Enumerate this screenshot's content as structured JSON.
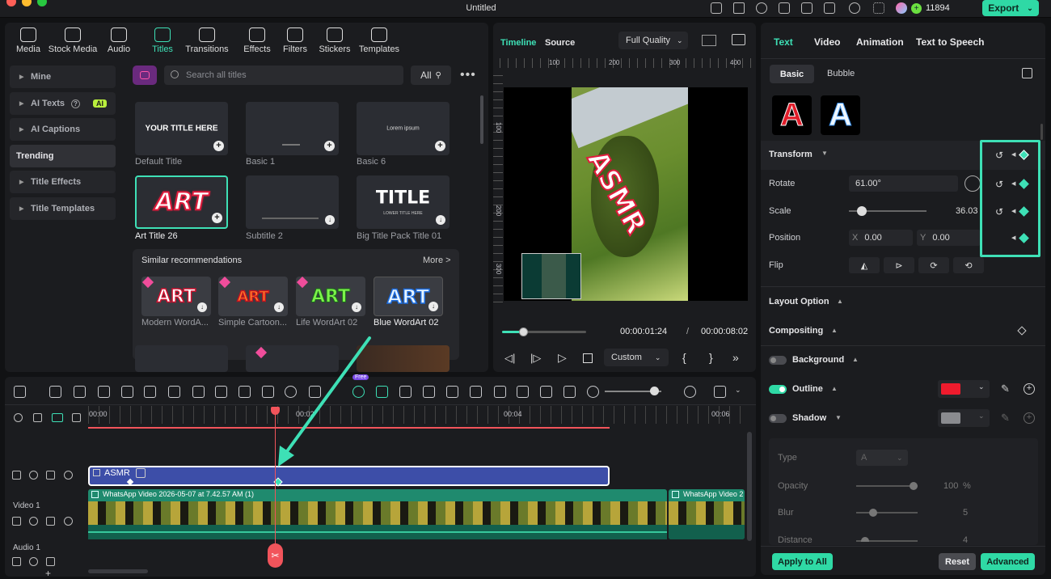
{
  "window": {
    "title": "Untitled",
    "credits": "11894",
    "export_label": "Export"
  },
  "media_tabs": [
    {
      "label": "Media",
      "icon": "media-icon"
    },
    {
      "label": "Stock Media",
      "icon": "stock-media-icon"
    },
    {
      "label": "Audio",
      "icon": "music-note-icon"
    },
    {
      "label": "Titles",
      "icon": "title-t-icon",
      "active": true
    },
    {
      "label": "Transitions",
      "icon": "transitions-icon"
    },
    {
      "label": "Effects",
      "icon": "effects-icon"
    },
    {
      "label": "Filters",
      "icon": "filters-icon"
    },
    {
      "label": "Stickers",
      "icon": "stickers-icon"
    },
    {
      "label": "Templates",
      "icon": "templates-icon"
    }
  ],
  "sidebar": [
    {
      "label": "Mine"
    },
    {
      "label": "AI Texts",
      "badge": "AI"
    },
    {
      "label": "AI Captions"
    },
    {
      "label": "Trending",
      "active": true
    },
    {
      "label": "Title Effects"
    },
    {
      "label": "Title Templates"
    }
  ],
  "search": {
    "placeholder": "Search all titles",
    "filter_label": "All"
  },
  "titles": [
    {
      "name": "Default Title",
      "preview": "YOUR TITLE HERE"
    },
    {
      "name": "Basic 1",
      "preview": ""
    },
    {
      "name": "Basic 6",
      "preview": "Lorem ipsum"
    },
    {
      "name": "Art Title 26",
      "preview": "ART",
      "selected": true
    },
    {
      "name": "Subtitle 2",
      "preview": ""
    },
    {
      "name": "Big Title Pack Title 01",
      "preview": "TITLE",
      "sub": "LOWER TITLE HERE"
    }
  ],
  "recommendations": {
    "heading": "Similar recommendations",
    "more": "More >",
    "items": [
      {
        "name": "Modern WordA...",
        "preview": "ART"
      },
      {
        "name": "Simple Cartoon...",
        "preview": "ART"
      },
      {
        "name": "Life WordArt 02",
        "preview": "ART"
      },
      {
        "name": "Blue WordArt 02",
        "preview": "ART"
      }
    ]
  },
  "preview": {
    "tab_timeline": "Timeline",
    "tab_source": "Source",
    "quality": "Full Quality",
    "ruler": [
      "100",
      "200",
      "300",
      "400"
    ],
    "ruler_v": [
      "100",
      "200",
      "300"
    ],
    "overlay_text": "ASMR",
    "current_time": "00:00:01:24",
    "separator": "/",
    "total_time": "00:00:08:02",
    "speed": "Custom",
    "scrub_progress": 0.25
  },
  "props": {
    "tabs": [
      "Text",
      "Video",
      "Animation",
      "Text to Speech"
    ],
    "subtabs": [
      "Basic",
      "Bubble"
    ],
    "transform_label": "Transform",
    "rotate_label": "Rotate",
    "rotate_value": "61.00°",
    "scale_label": "Scale",
    "scale_value": "36.03",
    "position_label": "Position",
    "pos_x_label": "X",
    "pos_x": "0.00",
    "pos_y_label": "Y",
    "pos_y": "0.00",
    "flip_label": "Flip",
    "layout_option": "Layout Option",
    "compositing": "Compositing",
    "background": "Background",
    "outline": "Outline",
    "outline_color": "#ef1b2d",
    "shadow": "Shadow",
    "shadow_color": "#8a8b8f",
    "type_label": "Type",
    "type_value": "A",
    "opacity_label": "Opacity",
    "opacity_value": "100",
    "opacity_unit": "%",
    "blur_label": "Blur",
    "blur_value": "5",
    "distance_label": "Distance",
    "distance_value": "4",
    "apply_all": "Apply to All",
    "reset": "Reset",
    "advanced": "Advanced"
  },
  "timeline": {
    "ruler": [
      "00:00",
      "00:02",
      "00:04",
      "00:06"
    ],
    "title_clip": "ASMR",
    "video_clip": "WhatsApp Video 2026-05-07 at 7.42.57 AM (1)",
    "video_clip2": "WhatsApp Video 2",
    "track_video": "Video 1",
    "track_audio": "Audio 1",
    "new_badge": "Free"
  },
  "colors": {
    "accent": "#3ee0b6",
    "playhead": "#f2545b",
    "title_clip": "#3d4ea8",
    "video_clip": "#1f8a6e"
  }
}
